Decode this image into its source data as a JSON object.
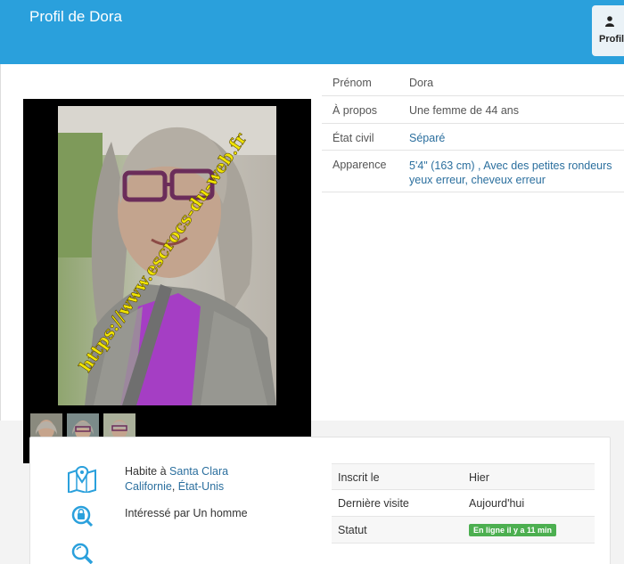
{
  "header": {
    "title": "Profil de Dora",
    "profile_tab_label": "Profil"
  },
  "photo": {
    "watermark": "https://www.escrocs-du-web.fr"
  },
  "info": [
    {
      "label": "Prénom",
      "value": "Dora"
    },
    {
      "label": "À propos",
      "value": "Une femme de 44 ans"
    },
    {
      "label": "État civil",
      "value": "Séparé"
    },
    {
      "label": "Apparence",
      "value_line1": "5'4\" (163 cm) , Avec des petites rondeurs",
      "value_line2": "yeux erreur, cheveux erreur"
    }
  ],
  "details": {
    "lives_prefix": "Habite à",
    "city": "Santa Clara",
    "state": "Californie",
    "country": "État-Unis",
    "interest_prefix": "Intéressé par",
    "interest_value": "Un homme"
  },
  "stats": [
    {
      "label": "Inscrit le",
      "value": "Hier"
    },
    {
      "label": "Dernière visite",
      "value": "Aujourd'hui"
    },
    {
      "label": "Statut",
      "badge": "En ligne il y a 11 min"
    }
  ],
  "colors": {
    "header": "#2aa0dc",
    "link": "#2b6f9e",
    "online": "#4caf50",
    "icon": "#2aa0dc"
  }
}
